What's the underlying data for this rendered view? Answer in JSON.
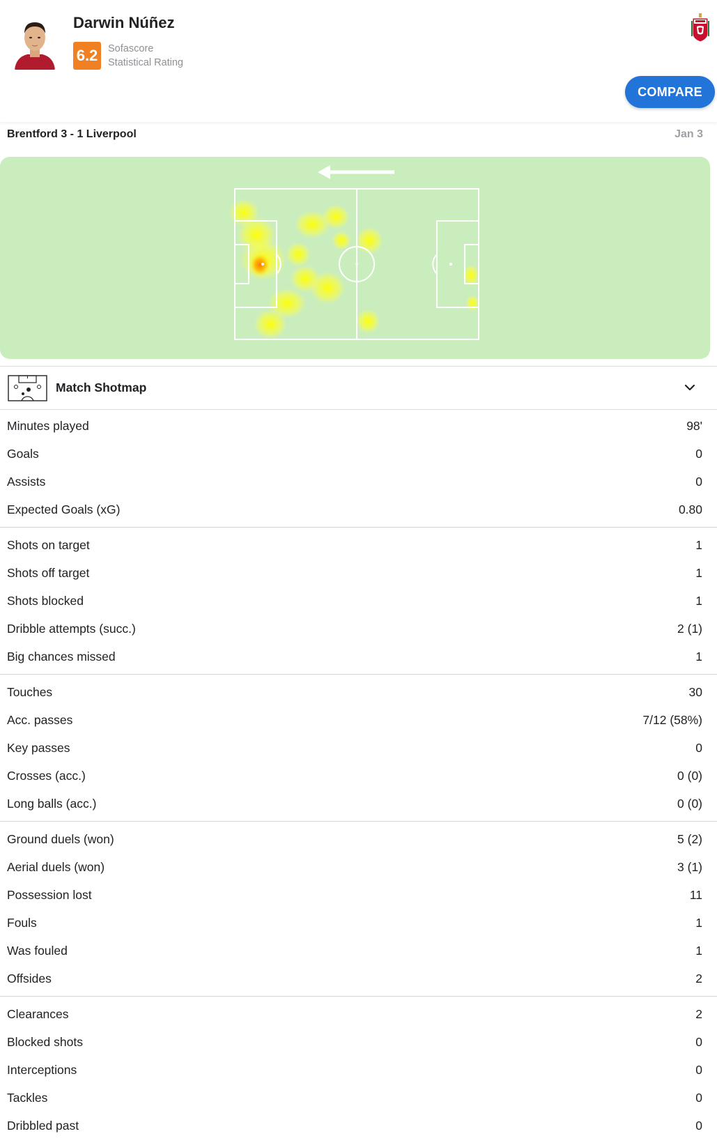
{
  "player": {
    "name": "Darwin Núñez",
    "rating": "6.2",
    "rating_label_line1": "Sofascore",
    "rating_label_line2": "Statistical Rating",
    "avatar_icon": "player-photo",
    "club_icon": "liverpool-crest-icon"
  },
  "actions": {
    "compare_label": "COMPARE"
  },
  "match": {
    "title": "Brentford 3 - 1 Liverpool",
    "date": "Jan 3"
  },
  "heatmap": {
    "direction_icon": "arrow-left-icon",
    "colors": {
      "pitch": "#c9edbd",
      "heat_low": "#ffff33",
      "heat_high": "#ff8c00"
    }
  },
  "shotmap": {
    "label": "Match Shotmap",
    "icon": "pitch-shotmap-icon",
    "toggle_icon": "chevron-down-icon"
  },
  "stat_groups": [
    {
      "rows": [
        {
          "label": "Minutes played",
          "value": "98'"
        },
        {
          "label": "Goals",
          "value": "0"
        },
        {
          "label": "Assists",
          "value": "0"
        },
        {
          "label": "Expected Goals (xG)",
          "value": "0.80"
        }
      ]
    },
    {
      "rows": [
        {
          "label": "Shots on target",
          "value": "1"
        },
        {
          "label": "Shots off target",
          "value": "1"
        },
        {
          "label": "Shots blocked",
          "value": "1"
        },
        {
          "label": "Dribble attempts (succ.)",
          "value": "2 (1)"
        },
        {
          "label": "Big chances missed",
          "value": "1"
        }
      ]
    },
    {
      "rows": [
        {
          "label": "Touches",
          "value": "30"
        },
        {
          "label": "Acc. passes",
          "value": "7/12 (58%)"
        },
        {
          "label": "Key passes",
          "value": "0"
        },
        {
          "label": "Crosses (acc.)",
          "value": "0 (0)"
        },
        {
          "label": "Long balls (acc.)",
          "value": "0 (0)"
        }
      ]
    },
    {
      "rows": [
        {
          "label": "Ground duels (won)",
          "value": "5 (2)"
        },
        {
          "label": "Aerial duels (won)",
          "value": "3 (1)"
        },
        {
          "label": "Possession lost",
          "value": "11"
        },
        {
          "label": "Fouls",
          "value": "1"
        },
        {
          "label": "Was fouled",
          "value": "1"
        },
        {
          "label": "Offsides",
          "value": "2"
        }
      ]
    },
    {
      "rows": [
        {
          "label": "Clearances",
          "value": "2"
        },
        {
          "label": "Blocked shots",
          "value": "0"
        },
        {
          "label": "Interceptions",
          "value": "0"
        },
        {
          "label": "Tackles",
          "value": "0"
        },
        {
          "label": "Dribbled past",
          "value": "0"
        }
      ]
    }
  ]
}
